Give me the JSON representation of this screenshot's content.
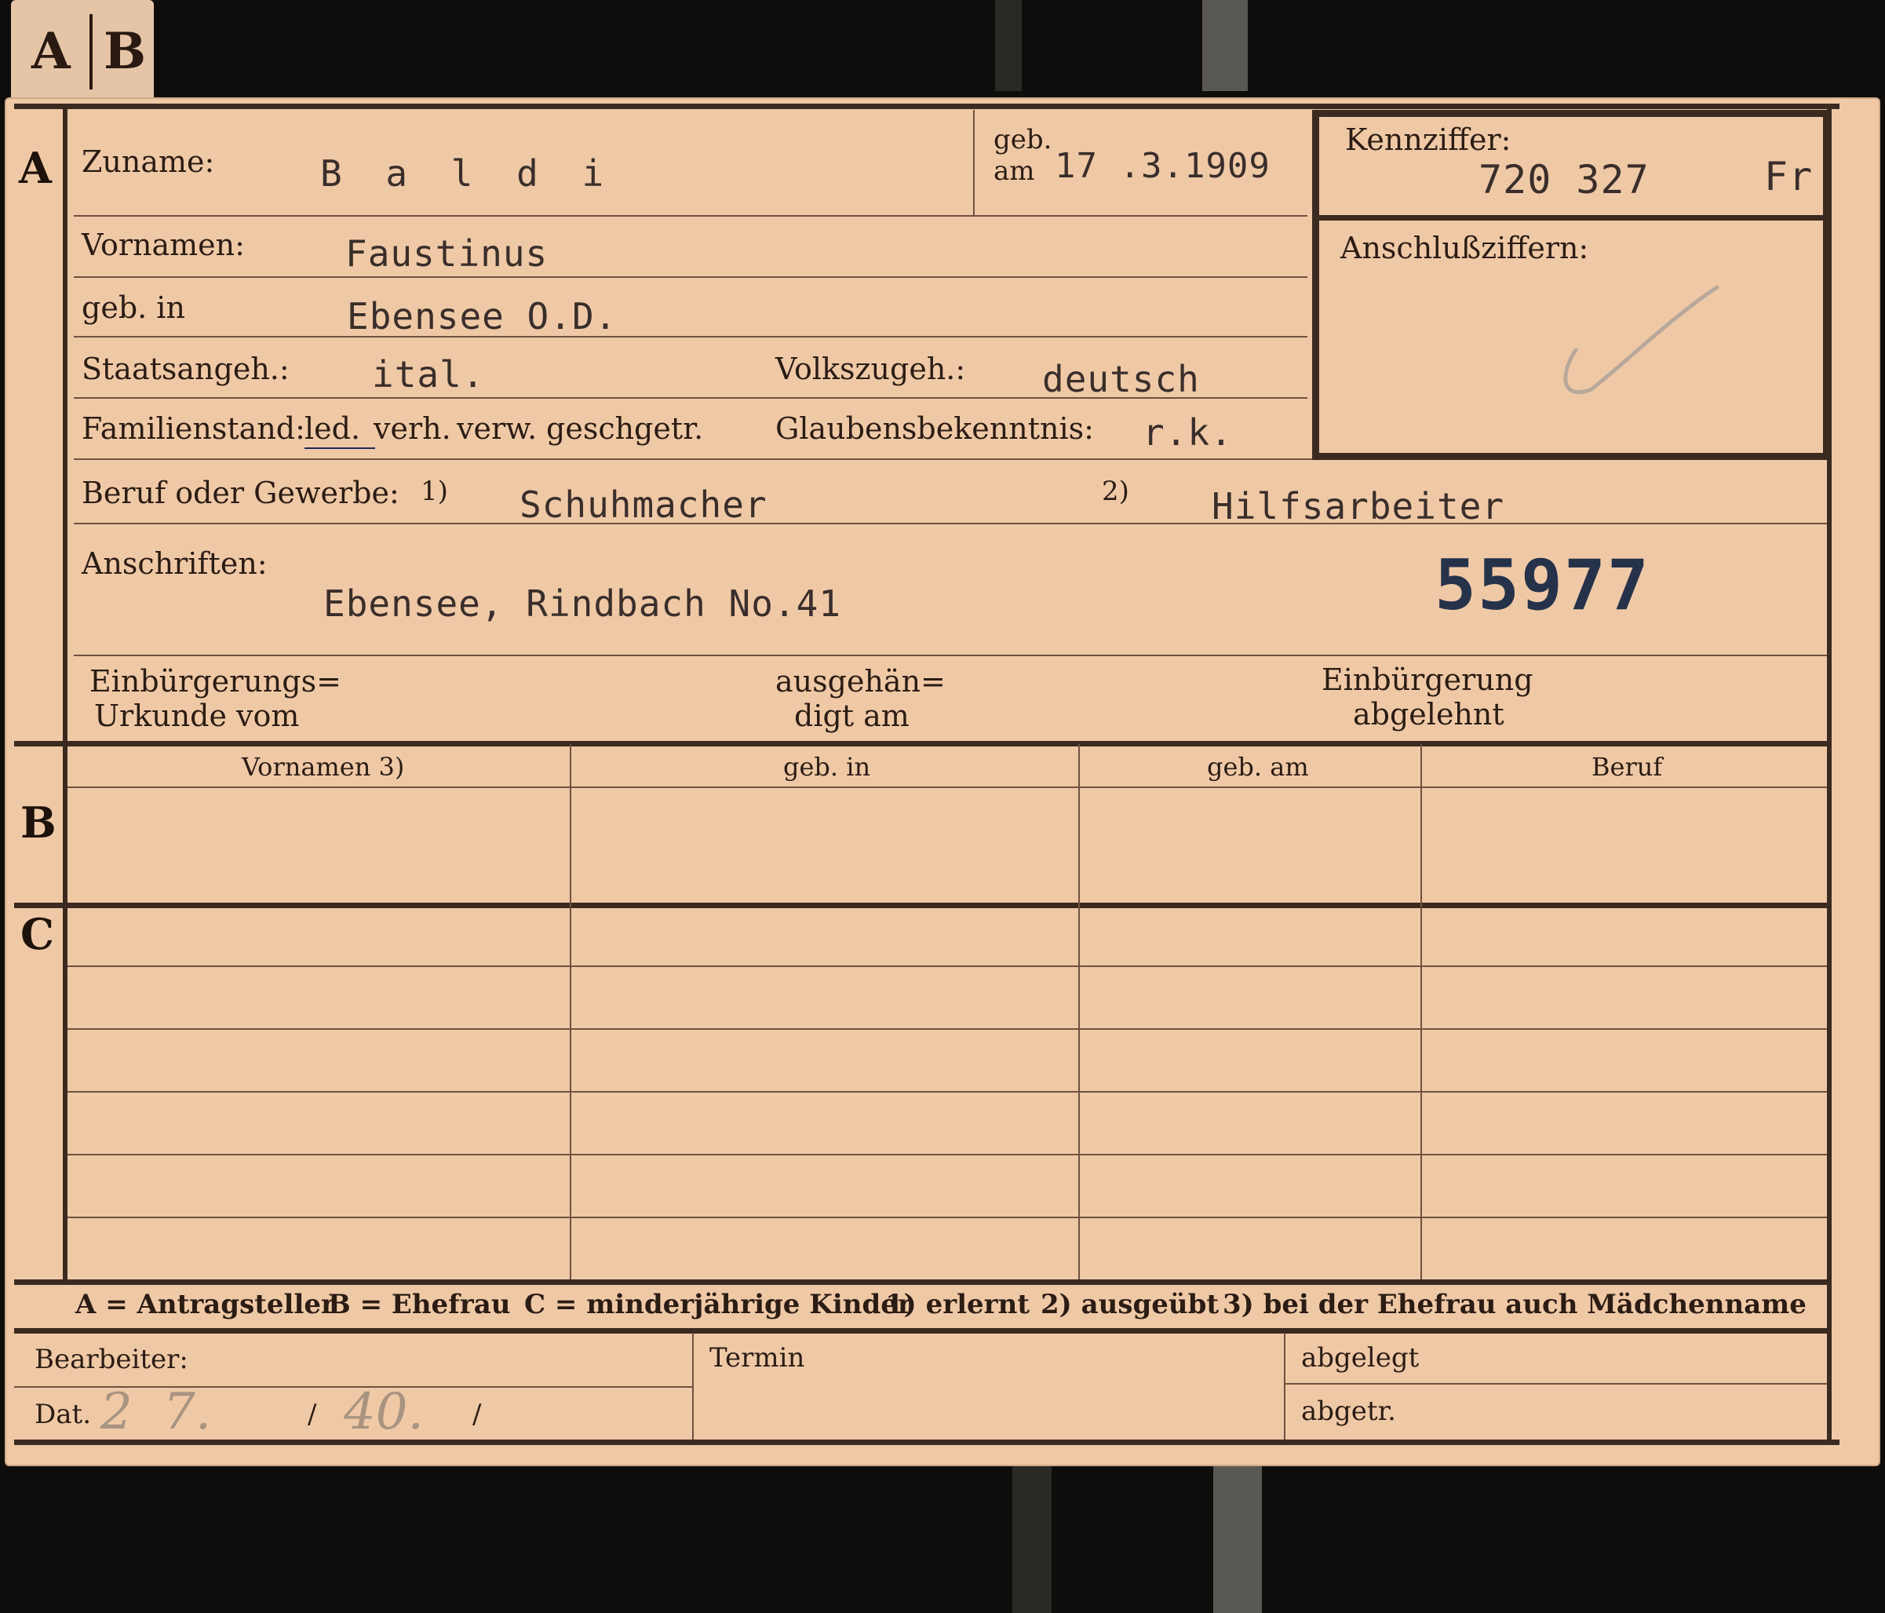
{
  "tab": {
    "a": "A",
    "b": "B"
  },
  "sections": {
    "a": "A",
    "b": "B",
    "c": "C"
  },
  "fields": {
    "zuname_label": "Zuname:",
    "zuname": "B a l d i",
    "geb_label_1": "geb.",
    "geb_label_2": "am",
    "geb_am": "17 .3.1909",
    "kennziffer_label": "Kennziffer:",
    "kennziffer": "720 327",
    "kennziffer_suffix": "Fr",
    "vornamen_label": "Vornamen:",
    "vornamen": "Faustinus",
    "anschlussziffern_label": "Anschlußziffern:",
    "geb_in_label": "geb. in",
    "geb_in": "Ebensee O.D.",
    "staatsangeh_label": "Staatsangeh.:",
    "staatsangeh": "ital.",
    "volkszugeh_label": "Volkszugeh.:",
    "volkszugeh": "deutsch",
    "familienstand_label": "Familienstand:",
    "familienstand_options": [
      "led.",
      "verh.",
      "verw.",
      "gesch.",
      "getr."
    ],
    "glaubens_label": "Glaubensbekenntnis:",
    "glaubens": "r.k.",
    "beruf_label": "Beruf oder Gewerbe:",
    "beruf_note1": "1)",
    "beruf_1": "Schuhmacher",
    "beruf_note2": "2)",
    "beruf_2": "Hilfsarbeiter",
    "anschriften_label": "Anschriften:",
    "anschrift": "Ebensee, Rindbach No.41",
    "stamp_number": "55977",
    "einbuerg_urkunde_1": "Einbürgerungs=",
    "einbuerg_urkunde_2": "Urkunde vom",
    "ausgehaen_1": "ausgehän=",
    "ausgehaen_2": "digt am",
    "abgelehnt_1": "Einbürgerung",
    "abgelehnt_2": "abgelehnt"
  },
  "table": {
    "headers": [
      "Vornamen 3)",
      "geb. in",
      "geb. am",
      "Beruf"
    ]
  },
  "legend": {
    "a": "A = Antragsteller",
    "b": "B = Ehefrau",
    "c": "C = minderjährige Kinder",
    "n1": "1) erlernt",
    "n2": "2) ausgeübt",
    "n3": "3) bei der Ehefrau auch Mädchenname"
  },
  "footer": {
    "bearbeiter_label": "Bearbeiter:",
    "dat_label": "Dat.",
    "dat_day": "2",
    "dat_month": "7.",
    "dat_sep1": "/",
    "dat_year": "40.",
    "dat_sep2": "/",
    "termin_label": "Termin",
    "abgelegt_label": "abgelegt",
    "abgetr_label": "abgetr."
  }
}
